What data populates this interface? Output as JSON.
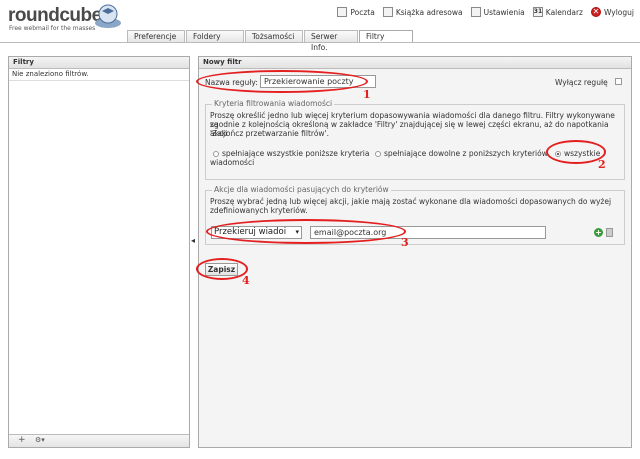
{
  "app": {
    "logo_text": "roundcube",
    "tagline": "Free webmail for the masses"
  },
  "topnav": [
    {
      "label": "Poczta",
      "icon": "mail-icon"
    },
    {
      "label": "Książka adresowa",
      "icon": "addressbook-icon"
    },
    {
      "label": "Ustawienia",
      "icon": "settings-icon"
    },
    {
      "label": "Kalendarz",
      "icon": "calendar-icon",
      "icon_text": "31"
    },
    {
      "label": "Wyloguj",
      "icon": "logout-icon",
      "icon_text": "✕"
    }
  ],
  "tabs": [
    {
      "label": "Preferencje",
      "active": false
    },
    {
      "label": "Foldery",
      "active": false
    },
    {
      "label": "Tożsamości",
      "active": false
    },
    {
      "label": "Serwer Info.",
      "active": false
    },
    {
      "label": "Filtry",
      "active": true
    }
  ],
  "left_panel": {
    "title": "Filtry",
    "empty_text": "Nie znaleziono filtrów.",
    "footer": {
      "add": "+",
      "menu": "⚙▾"
    }
  },
  "right_panel": {
    "title": "Nowy filtr",
    "rule_name_label": "Nazwa reguły:",
    "rule_name_value": "Przekierowanie poczty",
    "disable_label": "Wyłącz regułę",
    "criteria": {
      "legend": "Kryteria filtrowania wiadomości",
      "description_lines": [
        "Proszę określić jedno lub więcej kryterium dopasowywania wiadomości dla danego filtru. Filtry wykonywane są",
        "zgodnie z kolejnością określoną w zakładce 'Filtry' znajdującej się w lewej części ekranu, aż do napotkania akcji",
        "'Zakończ przetwarzanie filtrów'."
      ],
      "options": [
        {
          "label_lines": [
            "spełniające wszystkie poniższe kryteria",
            "wiadomości"
          ],
          "selected": false
        },
        {
          "label_lines": [
            "spełniające dowolne z poniższych kryteriów"
          ],
          "selected": false
        },
        {
          "label_lines": [
            "wszystkie"
          ],
          "selected": true
        }
      ]
    },
    "actions": {
      "legend": "Akcje dla wiadomości pasujących do kryteriów",
      "description_lines": [
        "Proszę wybrać jedną lub więcej akcji, jakie mają zostać wykonane dla wiadomości dopasowanych do wyżej",
        "zdefiniowanych kryteriów."
      ],
      "action_select": "Przekieruj wiadoi",
      "email_value": "email@poczta.org"
    },
    "save_label": "Zapisz"
  },
  "annotations": [
    "1",
    "2",
    "3",
    "4"
  ],
  "colors": {
    "annotation": "#e41f1f",
    "accent_green": "#3a9a3a"
  }
}
